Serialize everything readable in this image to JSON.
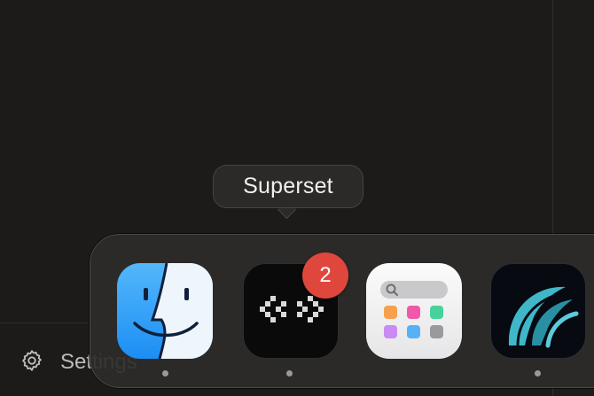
{
  "sidebar": {
    "settings_label": "Settings"
  },
  "tooltip": {
    "text": "Superset"
  },
  "dock": {
    "items": [
      {
        "name": "Finder",
        "icon": "finder-icon",
        "running": true
      },
      {
        "name": "Superset",
        "icon": "superset-icon",
        "running": true,
        "badge": "2"
      },
      {
        "name": "Launchpad",
        "icon": "launchpad-icon",
        "running": false
      },
      {
        "name": "Warp",
        "icon": "warp-icon",
        "running": true
      }
    ]
  },
  "colors": {
    "background": "#1b1a19",
    "badge": "#e0473c",
    "finder_blue": "#1c8ef4",
    "accent_teal": "#3fb7c9"
  }
}
